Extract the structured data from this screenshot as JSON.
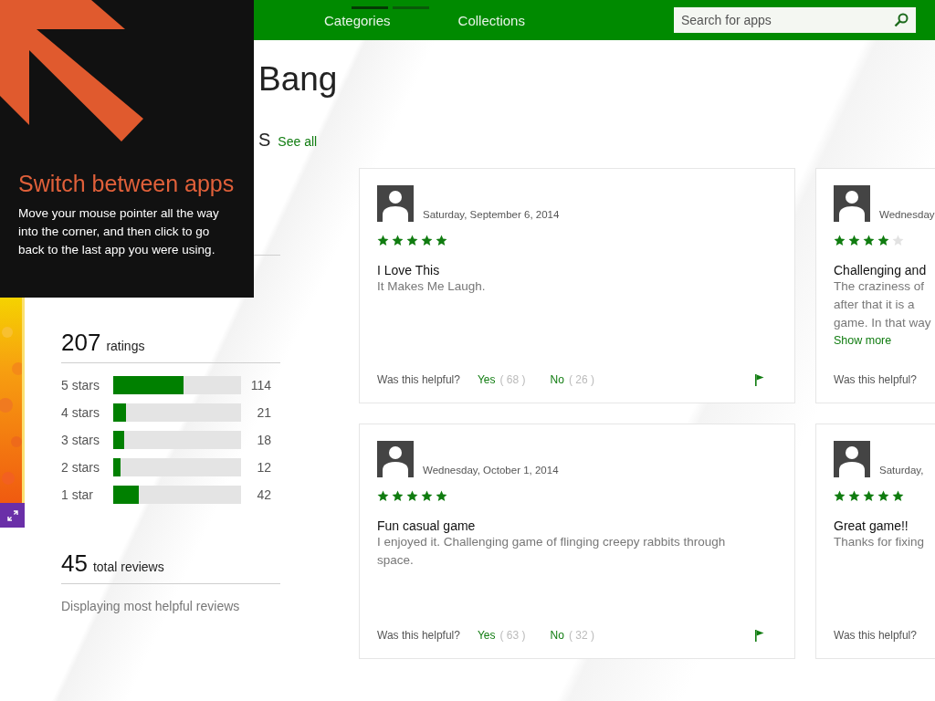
{
  "header": {
    "pager": [
      {
        "selected": true
      },
      {
        "selected": false
      }
    ],
    "tabs": [
      {
        "label": "Categories",
        "selected": false
      },
      {
        "label": "Collections",
        "selected": false
      }
    ],
    "search": {
      "placeholder": "Search for apps"
    }
  },
  "app": {
    "title": "Bang"
  },
  "reviews_heading": {
    "title": "S",
    "see_all": "See all"
  },
  "ratings": {
    "total": "207",
    "total_label": "ratings",
    "rows": [
      {
        "label": "5 stars",
        "level": 0.551,
        "count": "114"
      },
      {
        "label": "4 stars",
        "level": 0.101,
        "count": "21"
      },
      {
        "label": "3 stars",
        "level": 0.087,
        "count": "18"
      },
      {
        "label": "2 stars",
        "level": 0.058,
        "count": "12"
      },
      {
        "label": "1 star",
        "level": 0.203,
        "count": "42"
      }
    ]
  },
  "review_count": {
    "total": "45",
    "total_label": "total reviews",
    "note": "Displaying most helpful reviews"
  },
  "reviews": [
    {
      "date": "Saturday, September 6, 2014",
      "stars": 5,
      "title": "I Love This",
      "body": [
        "It Makes Me Laugh."
      ],
      "helpful_label": "Was this helpful?",
      "yes": "Yes",
      "yes_count": "( 68 )",
      "no": "No",
      "no_count": "( 26 )"
    },
    {
      "date": "Wednesday",
      "stars": 4,
      "title": "Challenging and",
      "body": [
        "The craziness of",
        "after that it is a",
        "game. In that way"
      ],
      "show_more": "Show more",
      "helpful_label": "Was this helpful?"
    },
    {
      "date": "Wednesday, October 1, 2014",
      "stars": 5,
      "title": "Fun casual game",
      "body": [
        "I enjoyed it.  Challenging game of flinging creepy rabbits through",
        "space."
      ],
      "helpful_label": "Was this helpful?",
      "yes": "Yes",
      "yes_count": "( 63 )",
      "no": "No",
      "no_count": "( 32 )"
    },
    {
      "date": "Saturday,",
      "stars": 5,
      "title": "Great game!!",
      "body": [
        "Thanks for fixing"
      ],
      "helpful_label": "Was this helpful?"
    }
  ],
  "tip": {
    "title": "Switch between apps",
    "body": "Move your mouse pointer all the way into the corner, and then click to go back to the last app you were using."
  }
}
